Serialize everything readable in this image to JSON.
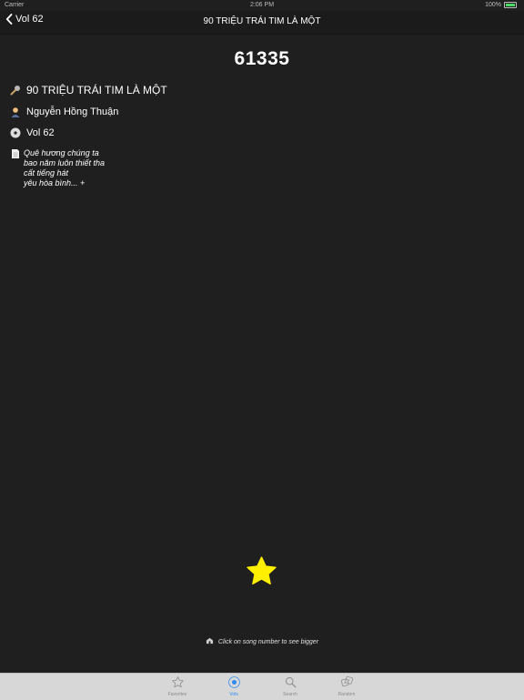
{
  "status_bar": {
    "carrier": "Carrier",
    "time": "2:06 PM",
    "battery": "100%"
  },
  "nav": {
    "back_label": "Vol 62",
    "title": "90 TRIỆU TRÁI TIM LÀ MỘT"
  },
  "song": {
    "number": "61335",
    "title": "90 TRIỆU TRÁI TIM LÀ MỘT",
    "author": "Nguyễn Hồng Thuận",
    "volume": "Vol 62",
    "lyrics_preview": [
      "Quê hương chúng ta",
      "bao năm luôn thiết tha",
      "cất tiếng hát",
      "yêu hòa bình... +"
    ]
  },
  "favorite": {
    "icon": "star-icon",
    "color": "#ffef00"
  },
  "hint": "Click on song number to see bigger",
  "tabs": [
    {
      "label": "Favorites",
      "icon": "star-outline-icon",
      "active": false
    },
    {
      "label": "Vols",
      "icon": "disc-icon",
      "active": true
    },
    {
      "label": "Search",
      "icon": "search-icon",
      "active": false
    },
    {
      "label": "Random",
      "icon": "dice-icon",
      "active": false
    }
  ]
}
